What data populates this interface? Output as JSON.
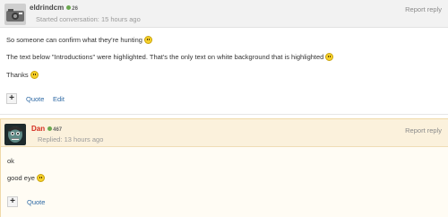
{
  "posts": [
    {
      "author": "eldrindcm",
      "reputation": "26",
      "timestamp": "Started conversation: 15 hours ago",
      "report_label": "Report reply",
      "lines": [
        "So someone can confirm what they're hunting",
        "The text below \"Introductions\" were highlighted. That's the only text on white background that is highlighted",
        "Thanks"
      ],
      "actions": {
        "plus": "+",
        "quote": "Quote",
        "edit": "Edit"
      }
    },
    {
      "author": "Dan",
      "reputation": "467",
      "timestamp": "Replied: 13 hours ago",
      "report_label": "Report reply",
      "lines": [
        "ok",
        "good eye"
      ],
      "actions": {
        "plus": "+",
        "quote": "Quote"
      }
    }
  ],
  "icons": {
    "smiley": "smiley-icon",
    "reputation": "reputation-dot-icon"
  },
  "colors": {
    "link": "#2f6aa5",
    "reply_author": "#d42b1e",
    "reply_background": "#fffcf4",
    "reply_border": "#f0d9a8",
    "reputation_dot": "#6aa84f",
    "smiley": "#f6d12a"
  }
}
